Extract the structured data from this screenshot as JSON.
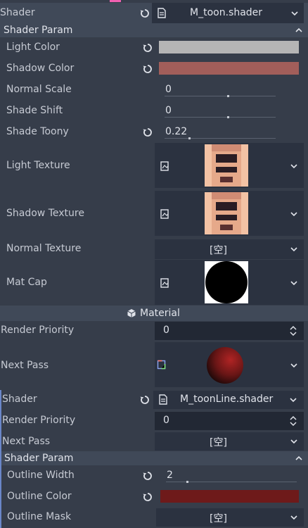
{
  "top": {
    "label": "Shader",
    "file": "M_toon.shader"
  },
  "shader_param_1": {
    "header": "Shader Param",
    "light_color": {
      "label": "Light Color",
      "color": "#b5b5b5"
    },
    "shadow_color": {
      "label": "Shadow Color",
      "color": "#a25e5a"
    },
    "normal_scale": {
      "label": "Normal Scale",
      "value": "0"
    },
    "shade_shift": {
      "label": "Shade Shift",
      "value": "0"
    },
    "shade_toony": {
      "label": "Shade Toony",
      "value": "0.22"
    },
    "light_texture": {
      "label": "Light Texture"
    },
    "shadow_texture": {
      "label": "Shadow Texture"
    },
    "normal_texture": {
      "label": "Normal Texture",
      "value": "[空]"
    },
    "mat_cap": {
      "label": "Mat Cap"
    }
  },
  "material": {
    "header": "Material"
  },
  "render_priority": {
    "label": "Render Priority",
    "value": "0"
  },
  "next_pass": {
    "label": "Next Pass"
  },
  "sub": {
    "shader": {
      "label": "Shader",
      "file": "M_toonLine.shader"
    },
    "render_priority": {
      "label": "Render Priority",
      "value": "0"
    },
    "next_pass": {
      "label": "Next Pass",
      "value": "[空]"
    },
    "shader_param": {
      "header": "Shader Param",
      "outline_width": {
        "label": "Outline Width",
        "value": "2"
      },
      "outline_color": {
        "label": "Outline Color",
        "color": "#6e1a1a"
      },
      "outline_mask": {
        "label": "Outline Mask",
        "value": "[空]"
      }
    }
  },
  "colors": {
    "accent": "#f060b0",
    "panel": "#363d4a",
    "field": "#222834",
    "header": "#404958"
  },
  "icons": [
    "reset-icon",
    "file-icon",
    "chevron-down-icon",
    "chevron-up-icon",
    "texture-icon",
    "material-icon",
    "spinner-icon",
    "next-pass-icon"
  ]
}
